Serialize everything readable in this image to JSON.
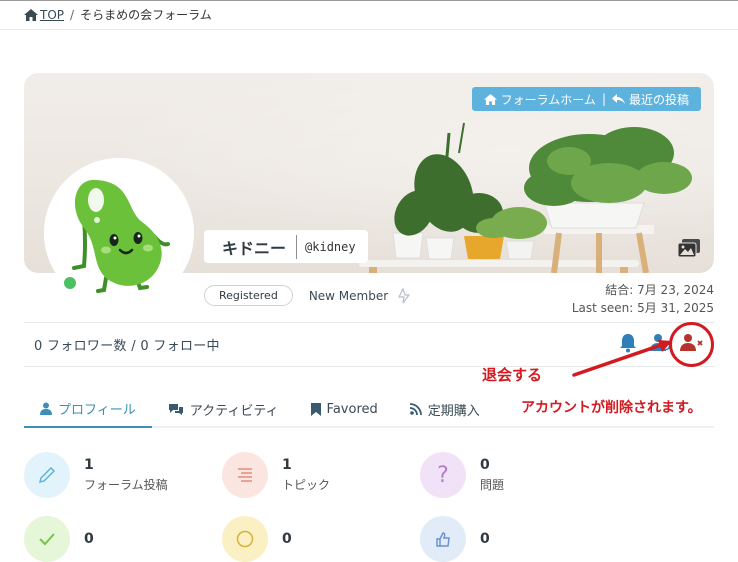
{
  "breadcrumb": {
    "home": "TOP",
    "separator": "/",
    "current": "そらまめの会フォーラム"
  },
  "cover": {
    "nav_home": "フォーラムホーム",
    "nav_separator": "|",
    "nav_recent": "最近の投稿"
  },
  "profile": {
    "display_name": "キドニー",
    "handle": "@kidney",
    "badge": "Registered",
    "rank": "New Member",
    "joined": "結合: 7月 23, 2024",
    "last_seen": "Last seen: 5月 31, 2025",
    "status_color": "#4cbf62"
  },
  "follow": {
    "text": "0 フォロワー数 / 0 フォロー中"
  },
  "annotation": {
    "withdraw": "退会する",
    "note": "アカウントが削除されます。",
    "color": "#d21a20"
  },
  "tabs": [
    {
      "label": "プロフィール",
      "icon": "user-icon",
      "active": true
    },
    {
      "label": "アクティビティ",
      "icon": "comments-icon",
      "active": false
    },
    {
      "label": "Favored",
      "icon": "bookmark-icon",
      "active": false
    },
    {
      "label": "定期購入",
      "icon": "rss-icon",
      "active": false
    }
  ],
  "stats": [
    {
      "value": "1",
      "label": "フォーラム投稿",
      "icon": "pencil-icon",
      "color": "#e3f3fb"
    },
    {
      "value": "1",
      "label": "トピック",
      "icon": "align-icon",
      "color": "#fbe5e1"
    },
    {
      "value": "0",
      "label": "問題",
      "icon": "question-icon",
      "color": "#f2e2f8"
    },
    {
      "value": "0",
      "label": "",
      "icon": "check-icon",
      "color": "#e6f6d8"
    },
    {
      "value": "0",
      "label": "",
      "icon": "smile-icon",
      "color": "#fbf0c4"
    },
    {
      "value": "0",
      "label": "",
      "icon": "thumbs-icon",
      "color": "#e2ebf8"
    }
  ]
}
